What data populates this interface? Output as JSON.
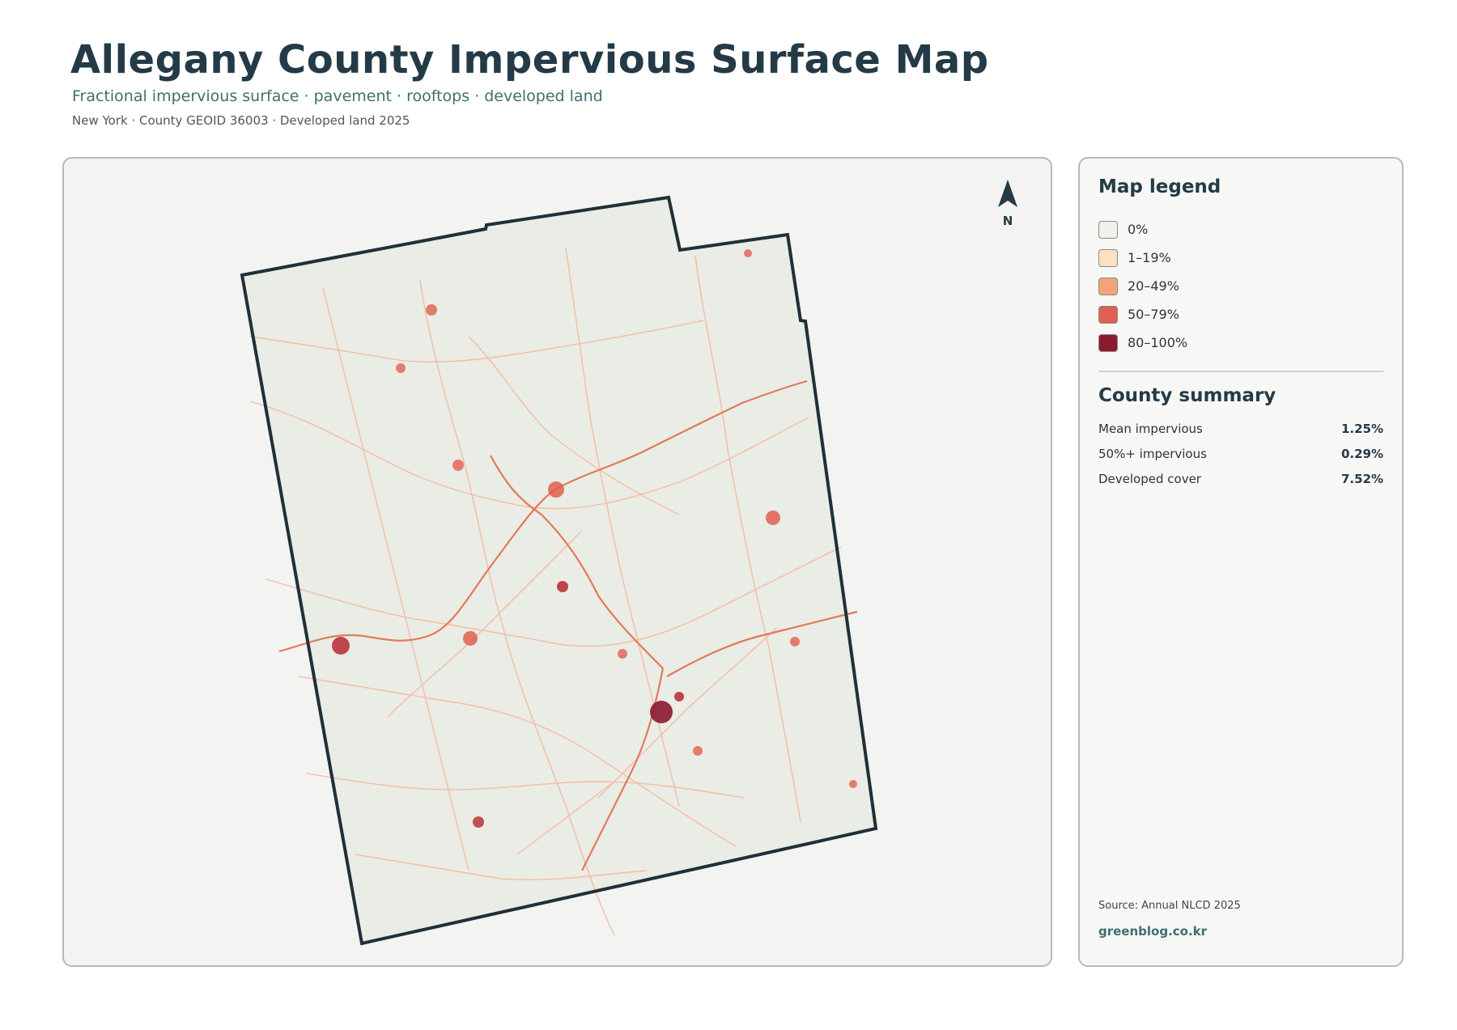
{
  "header": {
    "title": "Allegany County Impervious Surface Map",
    "subtitle": "Fractional impervious surface · pavement · rooftops · developed land",
    "meta": "New York · County GEOID 36003 · Developed land 2025"
  },
  "map": {
    "north_label": "N",
    "background_color": "#f3f3f1",
    "county_fill": "#eaece6",
    "boundary_color": "#1f3038"
  },
  "legend": {
    "title": "Map legend",
    "items": [
      {
        "label": "0%",
        "color": "#f0f0ec"
      },
      {
        "label": "1–19%",
        "color": "#fde0c0"
      },
      {
        "label": "20–49%",
        "color": "#f4a47a"
      },
      {
        "label": "50–79%",
        "color": "#e06050"
      },
      {
        "label": "80–100%",
        "color": "#8b1a2e"
      }
    ]
  },
  "summary": {
    "title": "County summary",
    "rows": [
      {
        "label": "Mean impervious",
        "value": "1.25%"
      },
      {
        "label": "50%+ impervious",
        "value": "0.29%"
      },
      {
        "label": "Developed cover",
        "value": "7.52%"
      }
    ]
  },
  "footer": {
    "source": "Source: Annual NLCD 2025",
    "brand": "greenblog.co.kr"
  }
}
